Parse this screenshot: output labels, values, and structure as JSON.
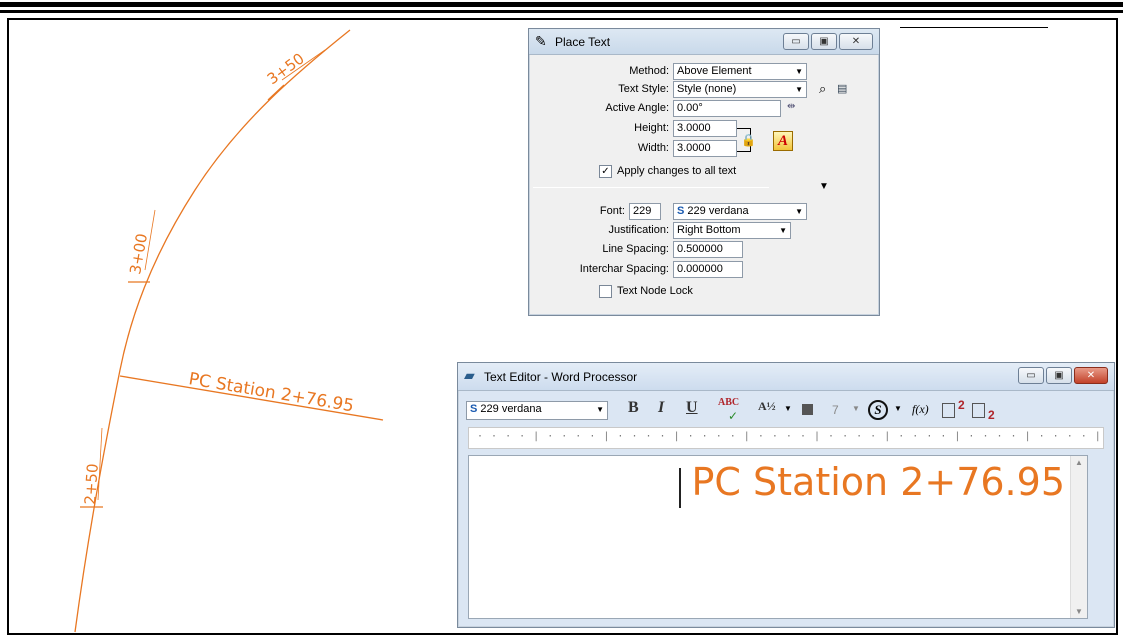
{
  "drawing": {
    "station_labels": [
      "3+50",
      "3+00",
      "2+50"
    ],
    "pc_label": "PC Station 2+76.95"
  },
  "place_text": {
    "title": "Place Text",
    "window_buttons": [
      "▭",
      "▣",
      "✕"
    ],
    "method_label": "Method:",
    "method_value": "Above Element",
    "text_style_label": "Text Style:",
    "text_style_value": "Style (none)",
    "active_angle_label": "Active Angle:",
    "active_angle_value": "0.00°",
    "height_label": "Height:",
    "height_value": "3.0000",
    "width_label": "Width:",
    "width_value": "3.0000",
    "apply_changes_label": "Apply changes to all text",
    "apply_changes_checked": true,
    "font_label": "Font:",
    "font_number": "229",
    "font_value": "229  verdana",
    "justification_label": "Justification:",
    "justification_value": "Right Bottom",
    "line_spacing_label": "Line Spacing:",
    "line_spacing_value": "0.500000",
    "interchar_spacing_label": "Interchar Spacing:",
    "interchar_spacing_value": "0.000000",
    "text_node_lock_label": "Text Node Lock",
    "text_node_lock_checked": false,
    "text_style_color_icon": "A"
  },
  "text_editor": {
    "title": "Text Editor - Word Processor",
    "window_buttons": [
      "▭",
      "▣",
      "✕"
    ],
    "font_value": "229  verdana",
    "bold": "B",
    "italic": "I",
    "underline": "U",
    "spell": "ABC",
    "fraction": "A½",
    "color_index": "7",
    "field_label": "f(x)",
    "superscript": "2",
    "subscript": "2",
    "content": "PC Station 2+76.95"
  },
  "colors": {
    "drawing_line": "#e87722",
    "text": "#e87722"
  }
}
